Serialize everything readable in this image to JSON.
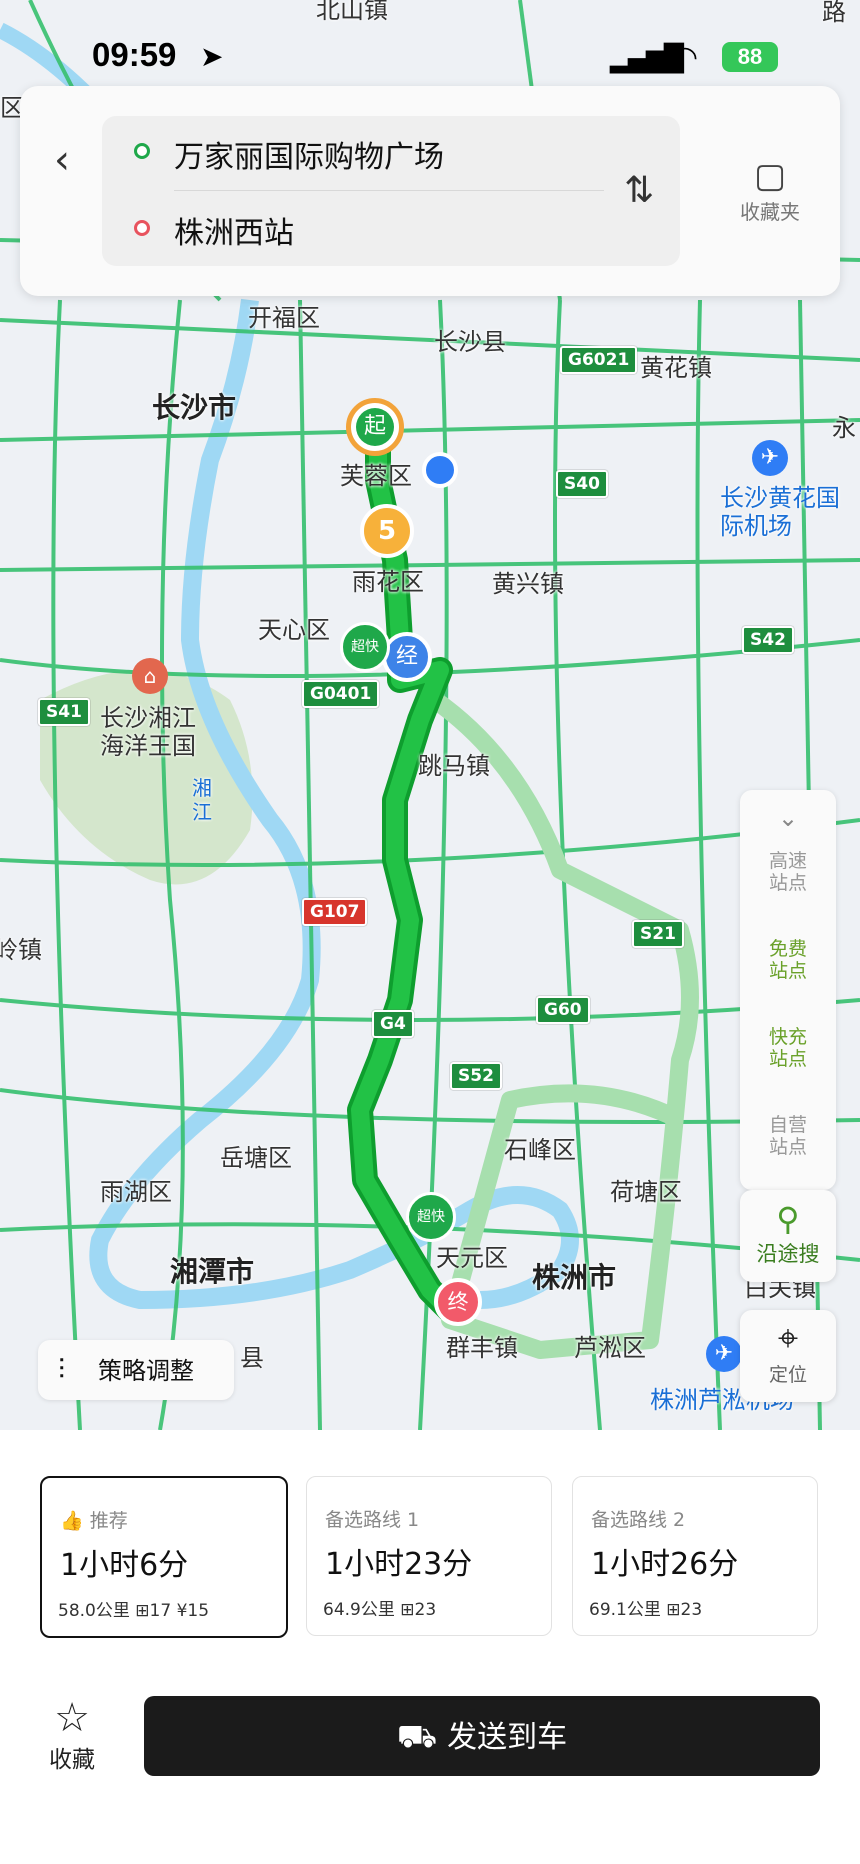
{
  "status_bar": {
    "time": "09:59",
    "battery": "88"
  },
  "route": {
    "origin": "万家丽国际购物广场",
    "destination": "株洲西站",
    "favorites_label": "收藏夹"
  },
  "map_labels": {
    "beishan": "北山镇",
    "kaifu": "开福区",
    "changsha_county": "长沙县",
    "huanghua": "黄花镇",
    "changsha_city": "长沙市",
    "furong": "芙蓉区",
    "airport": "长沙黄花国际机场",
    "yuhua": "雨花区",
    "huangxing": "黄兴镇",
    "tianxin": "天心区",
    "ocean_park": "长沙湘江海洋王国",
    "xiangjiang": "湘江",
    "tiaoma": "跳马镇",
    "yuetang": "岳塘区",
    "shifeng": "石峰区",
    "hetang": "荷塘区",
    "yuhu": "雨湖区",
    "xiangtan": "湘潭市",
    "tianyuan": "天元区",
    "zhuzhou": "株洲市",
    "qunfeng": "群丰镇",
    "lusong": "芦淞区",
    "zhuzhou_airport": "株洲芦淞机场",
    "baiguan": "白关镇",
    "county": "县",
    "ling_town": "岭镇",
    "yong": "永",
    "lu": "路",
    "cheng": "城区"
  },
  "road_shields": {
    "g6021": "G6021",
    "s40": "S40",
    "s42": "S42",
    "s41": "S41",
    "g0401": "G0401",
    "g107": "G107",
    "s21": "S21",
    "g4": "G4",
    "g60": "G60",
    "s52": "S52"
  },
  "markers": {
    "start": "起",
    "waypoint": "经",
    "end": "终",
    "number": "5",
    "fast_charge": "超快"
  },
  "side_panel": {
    "highway": "高速站点",
    "free": "免费站点",
    "fast": "快充站点",
    "self": "自营站点",
    "search_along": "沿途搜",
    "locate": "定位"
  },
  "strategy_label": "策略调整",
  "routes": [
    {
      "tag": "推荐",
      "time": "1小时6分",
      "distance": "58.0公里",
      "lights": "17",
      "toll": "¥15"
    },
    {
      "tag": "备选路线 1",
      "time": "1小时23分",
      "distance": "64.9公里",
      "lights": "23"
    },
    {
      "tag": "备选路线 2",
      "time": "1小时26分",
      "distance": "69.1公里",
      "lights": "23"
    }
  ],
  "bottom": {
    "fav_label": "收藏",
    "send_label": "发送到车"
  },
  "colors": {
    "route_main": "#17b03a",
    "route_alt": "#a7dfae",
    "road": "#2fbf6a",
    "water": "#8fd3f3",
    "park": "#cfe3c7"
  }
}
